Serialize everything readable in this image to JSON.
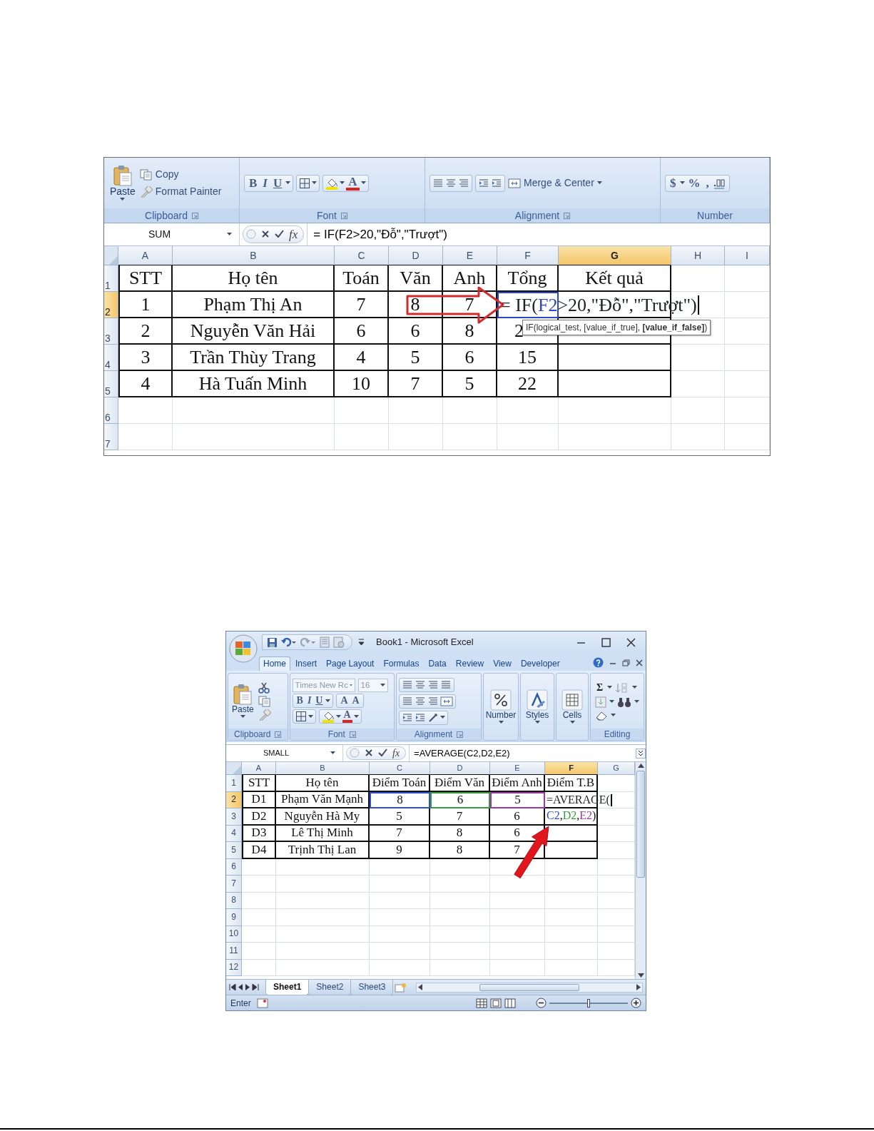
{
  "screenshot_1": {
    "ribbon": {
      "clipboard": {
        "label": "Clipboard",
        "paste": "Paste",
        "copy": "Copy",
        "format_painter": "Format Painter"
      },
      "font": {
        "label": "Font",
        "bold": "B",
        "italic": "I",
        "underline": "U",
        "font_color": "A"
      },
      "alignment": {
        "label": "Alignment",
        "merge": "Merge & Center"
      },
      "number": {
        "label": "Number",
        "currency": "$",
        "percent": "%",
        "comma": ","
      }
    },
    "formula_bar": {
      "name_box": "SUM",
      "insert_function": "fx",
      "formula": "= IF(F2>20,\"Đỗ\",\"Trượt\")"
    },
    "columns": [
      {
        "label": "A",
        "selected": false
      },
      {
        "label": "B",
        "selected": false
      },
      {
        "label": "C",
        "selected": false
      },
      {
        "label": "D",
        "selected": false
      },
      {
        "label": "E",
        "selected": false
      },
      {
        "label": "F",
        "selected": false
      },
      {
        "label": "G",
        "selected": true
      },
      {
        "label": "H",
        "selected": false
      },
      {
        "label": "I",
        "selected": false
      }
    ],
    "rows": [
      {
        "label": "1",
        "selected": false,
        "bordered": true,
        "cells": [
          "STT",
          "Họ tên",
          "Toán",
          "Văn",
          "Anh",
          "Tổng",
          "Kết quả"
        ]
      },
      {
        "label": "2",
        "selected": true,
        "bordered": true,
        "cells": [
          "1",
          "Phạm Thị An",
          "7",
          "8",
          "7",
          {
            "color": "#2f45c8",
            "editing": true,
            "parts": [
              {
                "text": "= IF("
              },
              {
                "text": "F2",
                "color": "#2f45c8"
              },
              {
                "text": ">20,\"Đỗ\",\"Trượt\")"
              }
            ]
          }
        ]
      },
      {
        "label": "3",
        "selected": false,
        "bordered": true,
        "cells": [
          "2",
          "Nguyễn Văn Hải",
          "6",
          "6",
          "8",
          {
            "text": "2",
            "covered": true
          }
        ]
      },
      {
        "label": "4",
        "selected": false,
        "bordered": true,
        "cells": [
          "3",
          "Trần Thùy Trang",
          "4",
          "5",
          "6",
          "15"
        ]
      },
      {
        "label": "5",
        "selected": false,
        "bordered": true,
        "cells": [
          "4",
          "Hà Tuấn Minh",
          "10",
          "7",
          "5",
          "22"
        ]
      },
      {
        "label": "6",
        "selected": false,
        "bordered": false
      },
      {
        "label": "7",
        "selected": false,
        "bordered": false
      }
    ],
    "tooltip": "IF(logical_test, [value_if_true], **[value_if_false]**)"
  },
  "screenshot_2": {
    "title": "Book1 - Microsoft Excel",
    "tabs": [
      {
        "label": "Home",
        "selected": true
      },
      {
        "label": "Insert",
        "selected": false
      },
      {
        "label": "Page Layout",
        "selected": false
      },
      {
        "label": "Formulas",
        "selected": false
      },
      {
        "label": "Data",
        "selected": false
      },
      {
        "label": "Review",
        "selected": false
      },
      {
        "label": "View",
        "selected": false
      },
      {
        "label": "Developer",
        "selected": false
      }
    ],
    "ribbon": {
      "clipboard": {
        "label": "Clipboard",
        "paste": "Paste"
      },
      "font": {
        "label": "Font",
        "font_name": "Times New Rc",
        "font_size": "16",
        "bold": "B",
        "italic": "I",
        "underline": "U",
        "grow_font": "A",
        "shrink_font": "A",
        "font_color": "A"
      },
      "alignment": {
        "label": "Alignment"
      },
      "number": {
        "label": "Number"
      },
      "styles": {
        "label": "Styles"
      },
      "cells": {
        "label": "Cells"
      },
      "editing": {
        "label": "Editing",
        "sum": "Σ"
      }
    },
    "formula_bar": {
      "name_box": "SMALL",
      "insert_function": "fx",
      "formula": "=AVERAGE(C2,D2,E2)"
    },
    "columns": [
      {
        "label": "A",
        "selected": false
      },
      {
        "label": "B",
        "selected": false
      },
      {
        "label": "C",
        "selected": false
      },
      {
        "label": "D",
        "selected": false
      },
      {
        "label": "E",
        "selected": false
      },
      {
        "label": "F",
        "selected": true
      },
      {
        "label": "G",
        "selected": false
      }
    ],
    "rows": [
      {
        "label": "1",
        "selected": false,
        "bordered": true,
        "cells": [
          "STT",
          "Họ tên",
          "Điểm Toán",
          "Điểm Văn",
          "Điểm Anh",
          "Điểm T.B"
        ]
      },
      {
        "label": "2",
        "selected": true,
        "bordered": true,
        "cells": [
          "D1",
          "Phạm Văn Mạnh",
          {
            "text": "8",
            "color": "#2f4fd0"
          },
          {
            "text": "6",
            "color": "#3a9a3a"
          },
          {
            "text": "5",
            "color": "#9a3aa0"
          },
          {
            "editing": true,
            "parts": [
              {
                "text": "=AVERAGE("
              }
            ]
          }
        ]
      },
      {
        "label": "3",
        "selected": false,
        "bordered": true,
        "cells": [
          "D2",
          "Nguyễn Hà My",
          "5",
          "7",
          "6",
          {
            "parts": [
              {
                "text": "C2",
                "color": "#2f4fd0"
              },
              {
                "text": ","
              },
              {
                "text": "D2",
                "color": "#3a9a3a"
              },
              {
                "text": ","
              },
              {
                "text": "E2",
                "color": "#9a3aa0"
              },
              {
                "text": ")"
              }
            ]
          }
        ]
      },
      {
        "label": "4",
        "selected": false,
        "bordered": true,
        "cells": [
          "D3",
          "Lê Thị Minh",
          "7",
          "8",
          "6"
        ]
      },
      {
        "label": "5",
        "selected": false,
        "bordered": true,
        "cells": [
          "D4",
          "Trịnh Thị Lan",
          "9",
          "8",
          "7"
        ]
      },
      {
        "label": "6",
        "selected": false,
        "bordered": false
      },
      {
        "label": "7",
        "selected": false,
        "bordered": false
      },
      {
        "label": "8",
        "selected": false,
        "bordered": false
      },
      {
        "label": "9",
        "selected": false,
        "bordered": false
      },
      {
        "label": "10",
        "selected": false,
        "bordered": false
      },
      {
        "label": "11",
        "selected": false,
        "bordered": false
      },
      {
        "label": "12",
        "selected": false,
        "bordered": false
      }
    ],
    "sheet_tabs": [
      {
        "label": "Sheet1",
        "selected": true
      },
      {
        "label": "Sheet2",
        "selected": false
      },
      {
        "label": "Sheet3",
        "selected": false
      }
    ],
    "status": "Enter",
    "zoom": {
      "level": 0.5
    }
  }
}
